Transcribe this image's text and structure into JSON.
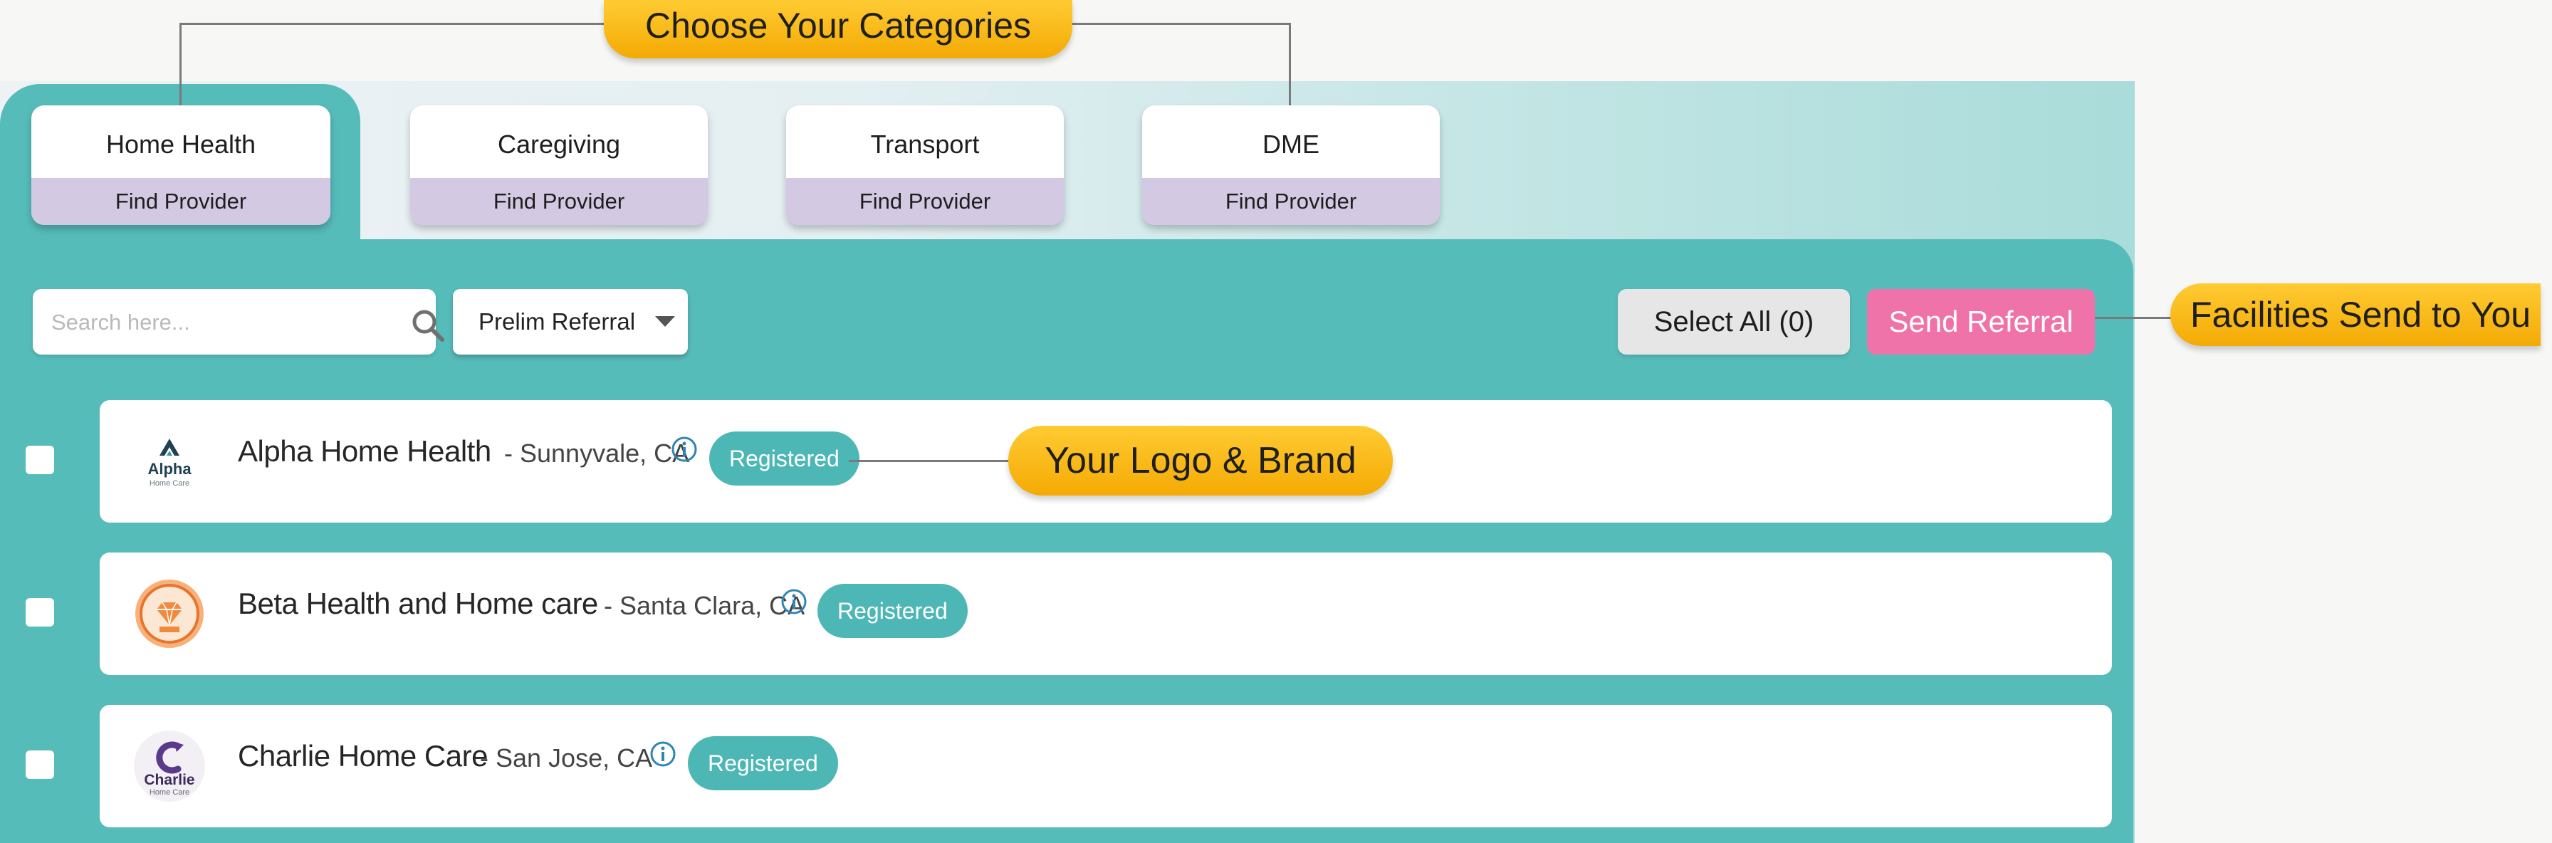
{
  "colors": {
    "teal_panel": "#56bcba",
    "tab_find_bg": "#d3c9e2",
    "callout_yellow": "#f9b90c",
    "send_pink": "#ef73a8",
    "badge_teal": "#4cb7b5"
  },
  "callouts": {
    "categories": "Choose Your Categories",
    "facilities": "Facilities Send to You",
    "logo_brand": "Your Logo & Brand"
  },
  "tabs": [
    {
      "label": "Home Health",
      "action": "Find Provider",
      "active": true
    },
    {
      "label": "Caregiving",
      "action": "Find Provider",
      "active": false
    },
    {
      "label": "Transport",
      "action": "Find Provider",
      "active": false
    },
    {
      "label": "DME",
      "action": "Find Provider",
      "active": false
    }
  ],
  "toolbar": {
    "search_placeholder": "Search here...",
    "search_icon": "magnifier-icon",
    "referral_type": "Prelim Referral",
    "select_all_label": "Select All (0)",
    "send_referral_label": "Send Referral"
  },
  "providers": [
    {
      "name": "Alpha Home Health",
      "location": "- Sunnyvale, CA",
      "status": "Registered",
      "checked": false,
      "logo": {
        "icon": "alpha-logo-icon",
        "text": "Alpha",
        "subtext": "Home Care"
      }
    },
    {
      "name": "Beta Health and Home care",
      "location": "- Santa Clara, CA",
      "status": "Registered",
      "checked": false,
      "logo": {
        "icon": "beta-logo-icon"
      }
    },
    {
      "name": "Charlie Home Care",
      "location": "- San Jose, CA",
      "status": "Registered",
      "checked": false,
      "logo": {
        "icon": "charlie-logo-icon",
        "text": "Charlie",
        "subtext": "Home Care"
      }
    }
  ]
}
